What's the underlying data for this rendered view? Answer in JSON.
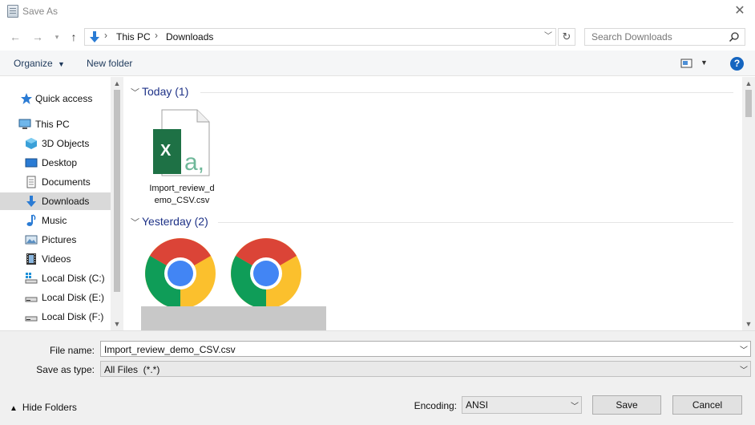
{
  "window": {
    "title": "Save As",
    "close_label": "✕"
  },
  "address_bar": {
    "path": [
      "This PC",
      "Downloads"
    ]
  },
  "search": {
    "placeholder": "Search Downloads"
  },
  "toolbar": {
    "organize_label": "Organize",
    "new_folder_label": "New folder",
    "help_label": "?"
  },
  "sidebar": {
    "items": [
      {
        "label": "Quick access",
        "icon": "quick-access-star-icon"
      },
      {
        "label": "This PC",
        "icon": "computer-icon"
      },
      {
        "label": "3D Objects",
        "icon": "3d-objects-icon"
      },
      {
        "label": "Desktop",
        "icon": "desktop-icon"
      },
      {
        "label": "Documents",
        "icon": "documents-icon"
      },
      {
        "label": "Downloads",
        "icon": "downloads-icon",
        "selected": true
      },
      {
        "label": "Music",
        "icon": "music-icon"
      },
      {
        "label": "Pictures",
        "icon": "pictures-icon"
      },
      {
        "label": "Videos",
        "icon": "videos-icon"
      },
      {
        "label": "Local Disk (C:)",
        "icon": "local-disk-c-icon"
      },
      {
        "label": "Local Disk (E:)",
        "icon": "local-disk-icon"
      },
      {
        "label": "Local Disk (F:)",
        "icon": "local-disk-icon"
      }
    ]
  },
  "content": {
    "groups": [
      {
        "label": "Today (1)"
      },
      {
        "label": "Yesterday (2)"
      }
    ],
    "files": [
      {
        "name_line1": "Import_review_d",
        "name_line2": "emo_CSV.csv",
        "icon": "excel-csv-file-icon"
      }
    ]
  },
  "form": {
    "file_name_label": "File name:",
    "file_name_value": "Import_review_demo_CSV.csv",
    "save_as_type_label": "Save as type:",
    "save_as_type_value": "All Files  (*.*)",
    "encoding_label": "Encoding:",
    "encoding_value": "ANSI"
  },
  "footer": {
    "hide_folders_label": "Hide Folders",
    "save_label": "Save",
    "cancel_label": "Cancel"
  },
  "colors": {
    "accent_blue": "#1e3287",
    "help_blue": "#1565c0",
    "excel_green": "#1e7145",
    "selection_gray": "#d9d9d9"
  }
}
